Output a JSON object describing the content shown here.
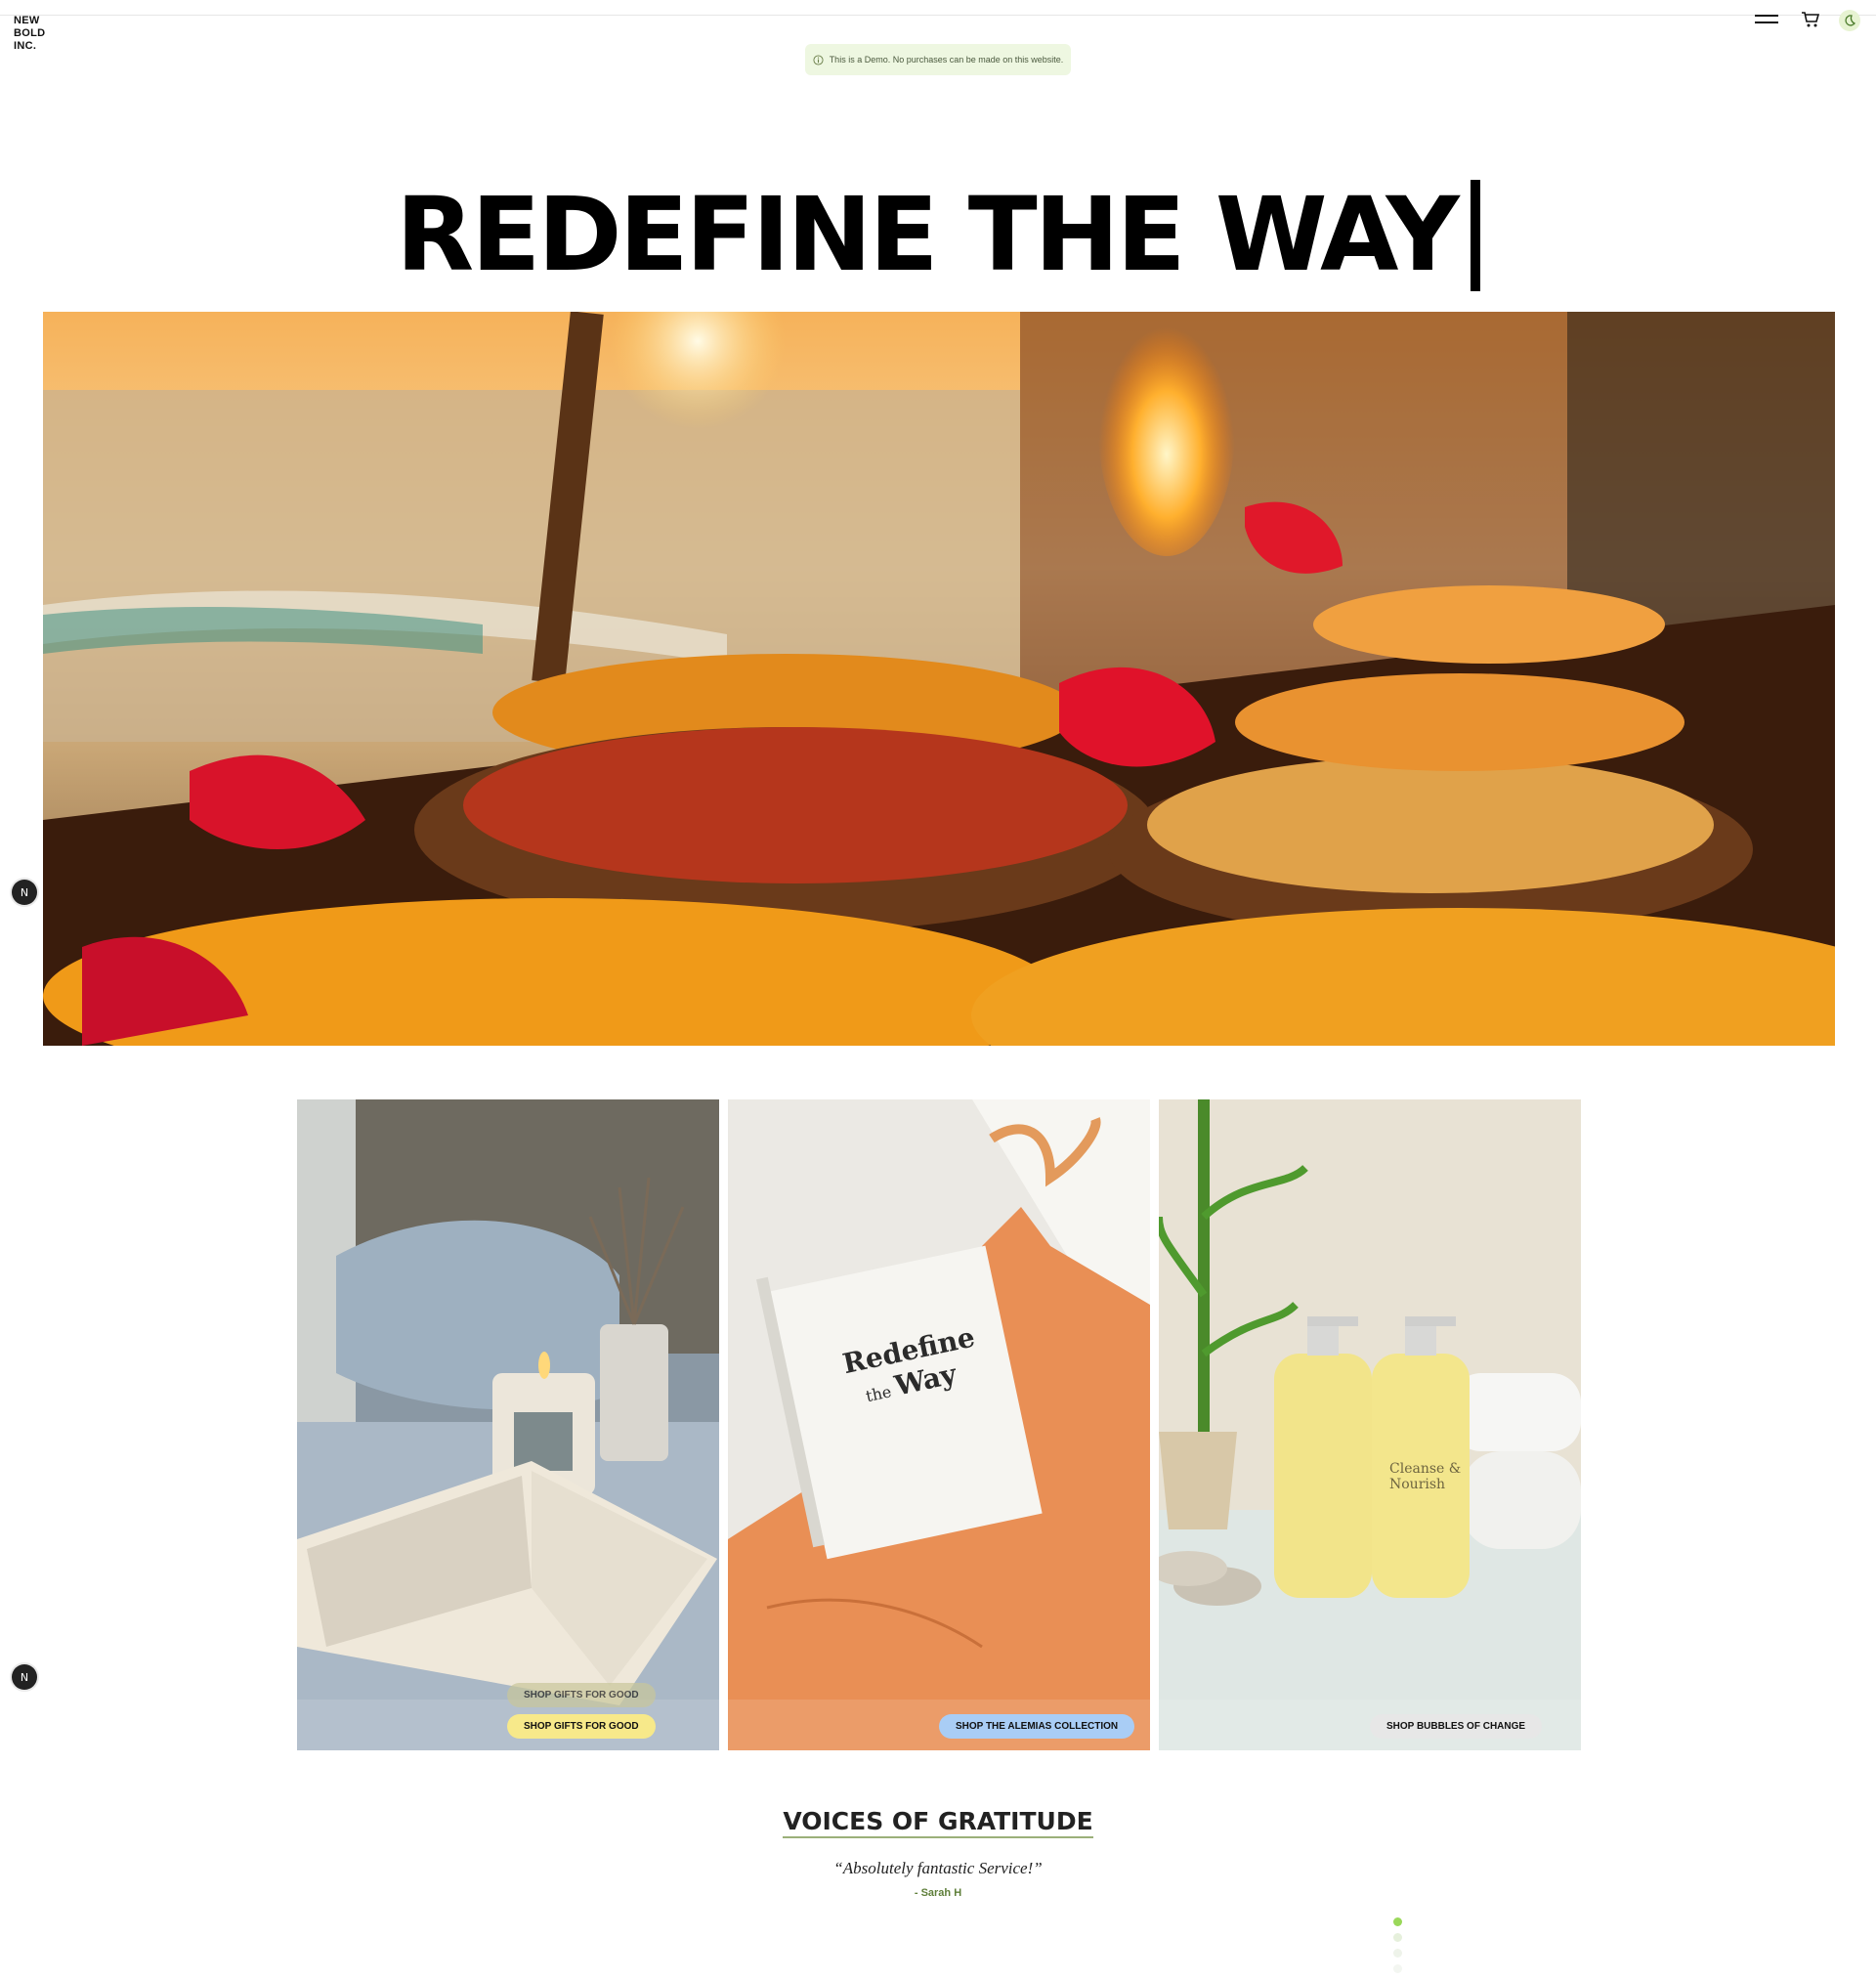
{
  "brand": {
    "logo_lines": [
      "NEW",
      "BOLD",
      "INC."
    ]
  },
  "header": {
    "menu_icon": "hamburger-menu-icon",
    "cart_icon": "cart-icon",
    "theme_icon": "moon-icon"
  },
  "notice": {
    "text": "This is a Demo. No purchases can be made on this website.",
    "icon": "info-icon",
    "bg_color": "#eef7e1"
  },
  "hero": {
    "title": "REDEFINE THE WAY"
  },
  "side_badges": [
    "N",
    "N"
  ],
  "cards": [
    {
      "button_label": "SHOP GIFTS FOR GOOD",
      "ghost_label": "SHOP GIFTS FOR GOOD",
      "button_color": "#f7e98a"
    },
    {
      "button_label": "SHOP THE ALEMIAS COLLECTION",
      "book_title_line1": "Redefine",
      "book_title_line2_small": "the",
      "book_title_line2": "Way",
      "button_color": "#a9cdf5"
    },
    {
      "button_label": "SHOP BUBBLES OF CHANGE",
      "bottle_label": "Cleanse & Nourish",
      "button_color": "#e7e7e7"
    }
  ],
  "testimonials": {
    "title": "VOICES OF GRATITUDE",
    "quote": "“Absolutely fantastic Service!”",
    "author": "- Sarah H",
    "active_index": 0,
    "count": 4
  },
  "colors": {
    "accent": "#9ad85a"
  }
}
